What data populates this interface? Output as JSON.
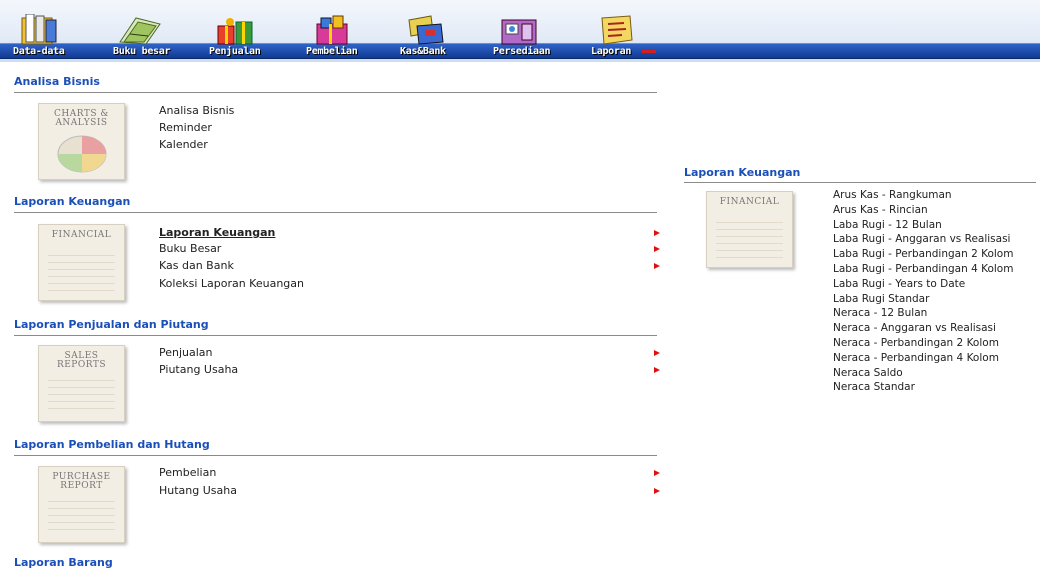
{
  "toolbar": {
    "items": [
      {
        "label": "Data-data",
        "icon": "folder-icon"
      },
      {
        "label": "Buku besar",
        "icon": "ledger-icon"
      },
      {
        "label": "Penjualan",
        "icon": "gift-icon"
      },
      {
        "label": "Pembelian",
        "icon": "shopping-icon"
      },
      {
        "label": "Kas&Bank",
        "icon": "cash-icon"
      },
      {
        "label": "Persediaan",
        "icon": "inventory-icon"
      },
      {
        "label": "Laporan",
        "icon": "report-scroll-icon"
      }
    ]
  },
  "sections": [
    {
      "title": "Analisa Bisnis",
      "thumb_caption": "CHARTS & ANALYSIS",
      "links": [
        "Analisa Bisnis",
        "Reminder",
        "Kalender"
      ]
    },
    {
      "title": "Laporan Keuangan",
      "thumb_caption": "FINANCIAL",
      "links": [
        "Laporan Keuangan",
        "Buku Besar",
        "Kas dan Bank",
        "Koleksi Laporan Keuangan"
      ]
    },
    {
      "title": "Laporan Penjualan dan Piutang",
      "thumb_caption": "SALES REPORTS",
      "links": [
        "Penjualan",
        "Piutang Usaha"
      ]
    },
    {
      "title": "Laporan Pembelian dan Hutang",
      "thumb_caption": "PURCHASE REPORT",
      "links": [
        "Pembelian",
        "Hutang Usaha"
      ]
    },
    {
      "title": "Laporan Barang"
    }
  ],
  "right_panel": {
    "title": "Laporan Keuangan",
    "thumb_caption": "FINANCIAL",
    "items": [
      "Arus Kas - Rangkuman",
      "Arus Kas - Rincian",
      "Laba Rugi - 12 Bulan",
      "Laba Rugi - Anggaran vs Realisasi",
      "Laba Rugi - Perbandingan 2 Kolom",
      "Laba Rugi - Perbandingan 4 Kolom",
      "Laba Rugi - Years to Date",
      "Laba Rugi Standar",
      "Neraca - 12 Bulan",
      "Neraca - Anggaran vs Realisasi",
      "Neraca - Perbandingan 2 Kolom",
      "Neraca - Perbandingan 4 Kolom",
      "Neraca Saldo",
      "Neraca Standar"
    ]
  },
  "colors": {
    "section_title": "#1b4fb8",
    "arrow": "#e01010",
    "toolbar_bar": "#1d4aa8"
  }
}
